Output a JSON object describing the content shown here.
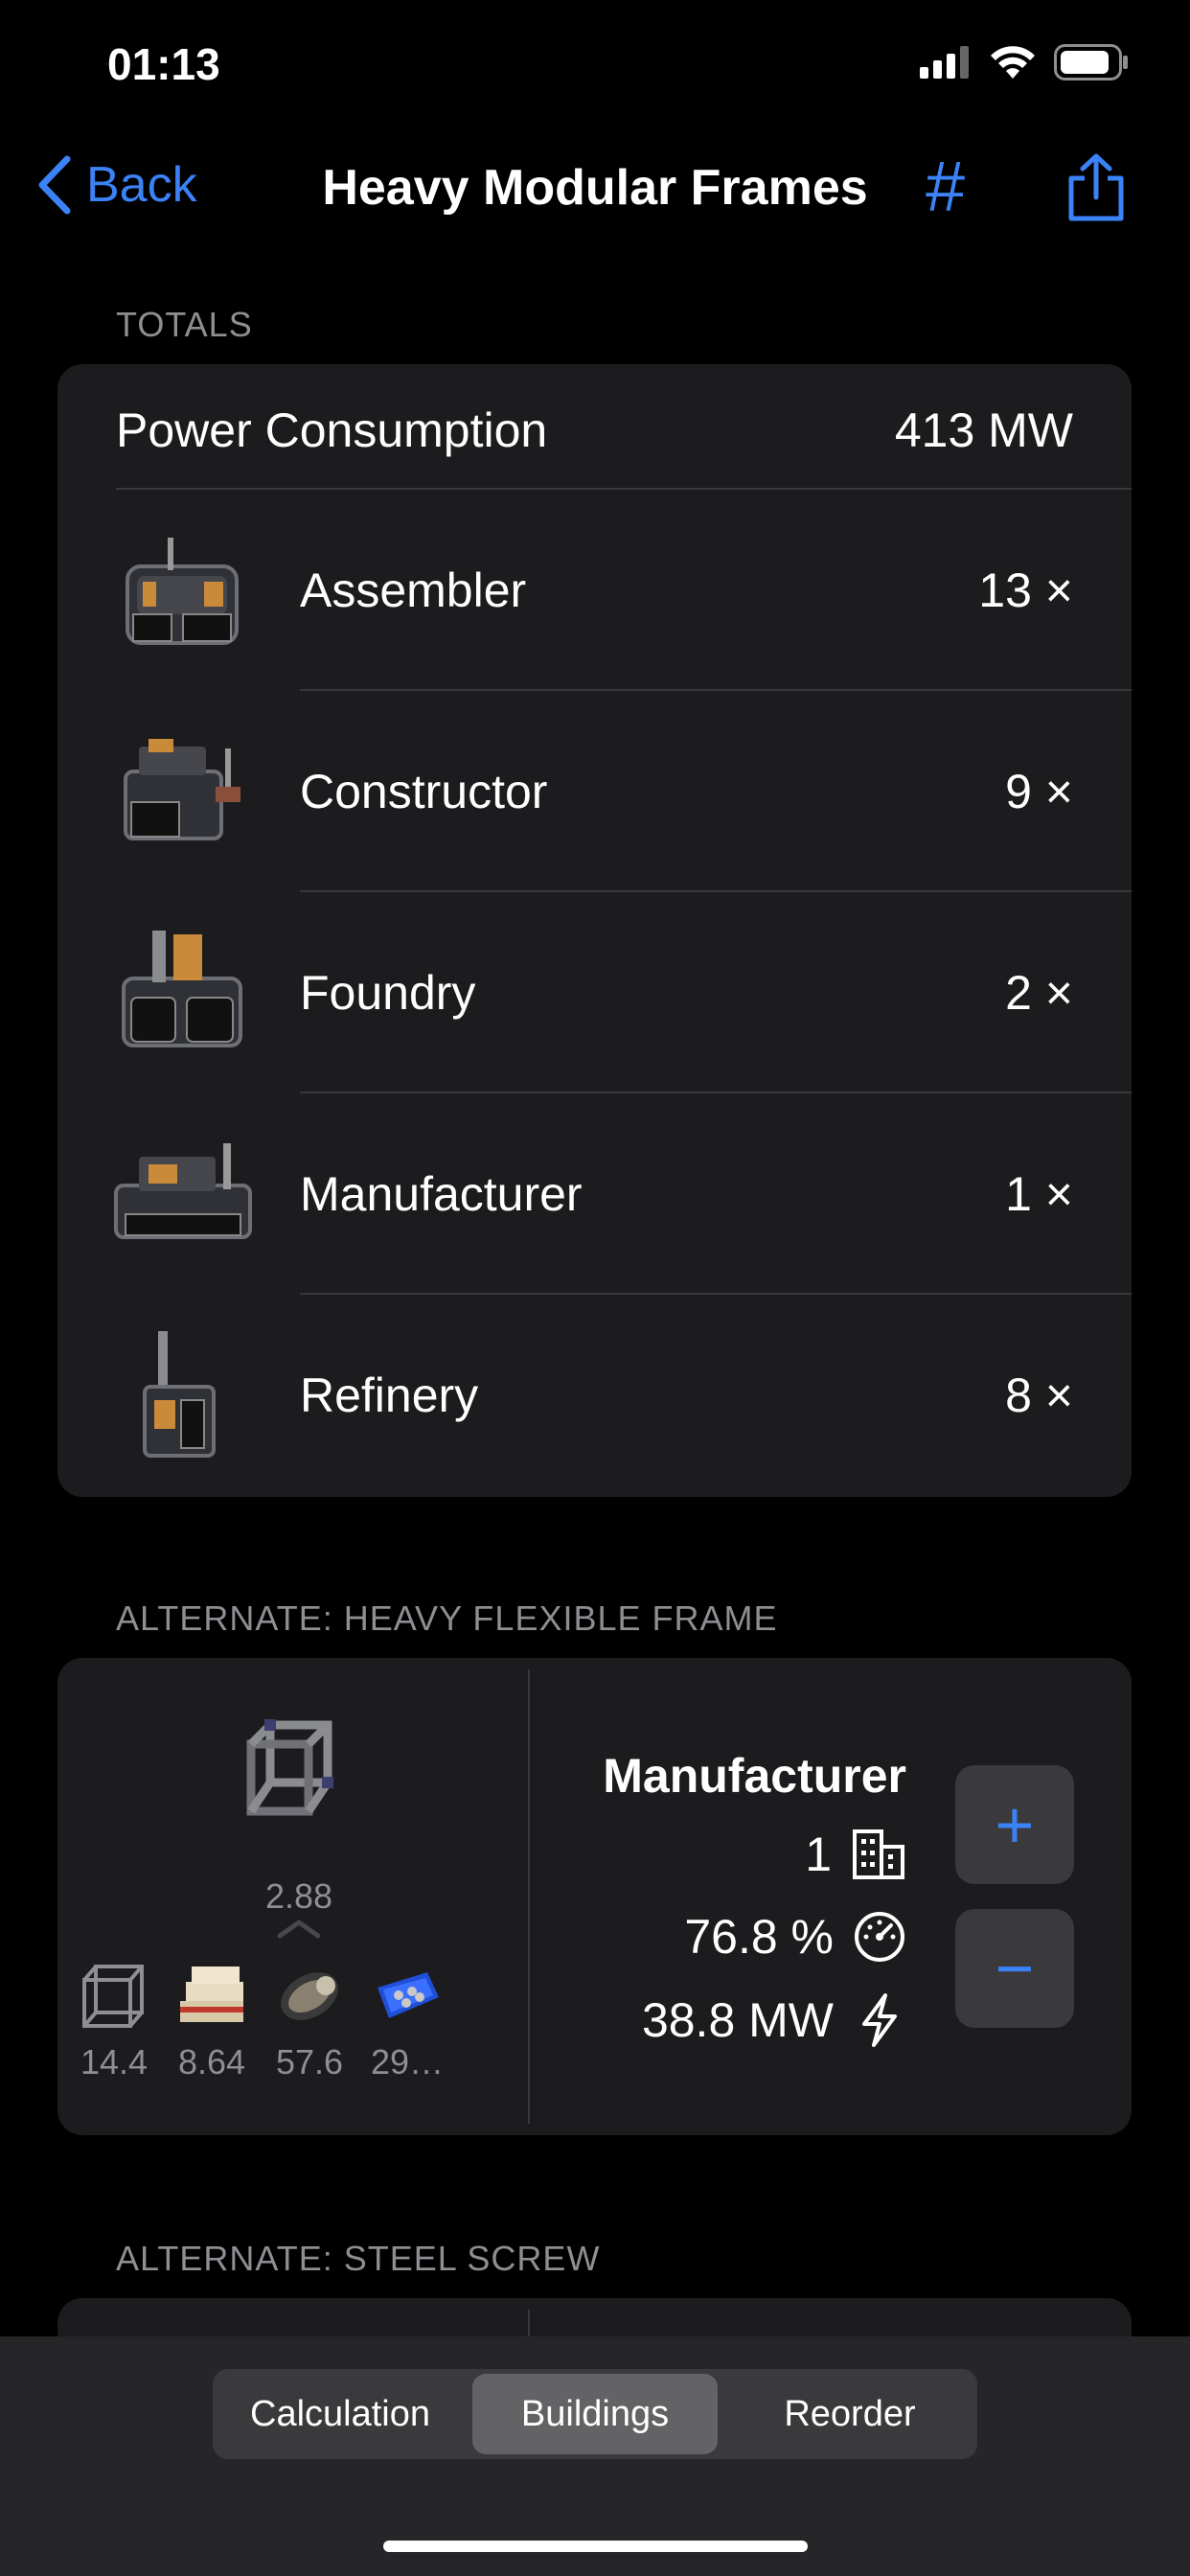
{
  "status": {
    "time": "01:13"
  },
  "nav": {
    "back_label": "Back",
    "title": "Heavy Modular Frames",
    "hash_label": "#"
  },
  "totals": {
    "header": "TOTALS",
    "power_label": "Power Consumption",
    "power_value": "413 MW",
    "buildings": [
      {
        "name": "Assembler",
        "count": "13 ×"
      },
      {
        "name": "Constructor",
        "count": "9 ×"
      },
      {
        "name": "Foundry",
        "count": "2 ×"
      },
      {
        "name": "Manufacturer",
        "count": "1 ×"
      },
      {
        "name": "Refinery",
        "count": "8 ×"
      }
    ]
  },
  "recipe": {
    "header": "ALTERNATE: HEAVY FLEXIBLE FRAME",
    "product_amount": "2.88",
    "ingredients": [
      {
        "icon": "frame-icon",
        "amount": "14.4"
      },
      {
        "icon": "encased-beam-icon",
        "amount": "8.64"
      },
      {
        "icon": "rotor-icon",
        "amount": "57.6"
      },
      {
        "icon": "screws-icon",
        "amount": "29…"
      }
    ],
    "building": "Manufacturer",
    "building_count": "1",
    "clock_speed": "76.8 %",
    "power": "38.8 MW",
    "plus_label": "+",
    "minus_label": "−"
  },
  "recipe2": {
    "header": "ALTERNATE: STEEL SCREW"
  },
  "tabs": {
    "items": [
      {
        "label": "Calculation"
      },
      {
        "label": "Buildings"
      },
      {
        "label": "Reorder"
      }
    ],
    "selected": "Buildings"
  },
  "colors": {
    "accent": "#3b82f6",
    "card": "#1c1c1e",
    "background": "#000000"
  }
}
